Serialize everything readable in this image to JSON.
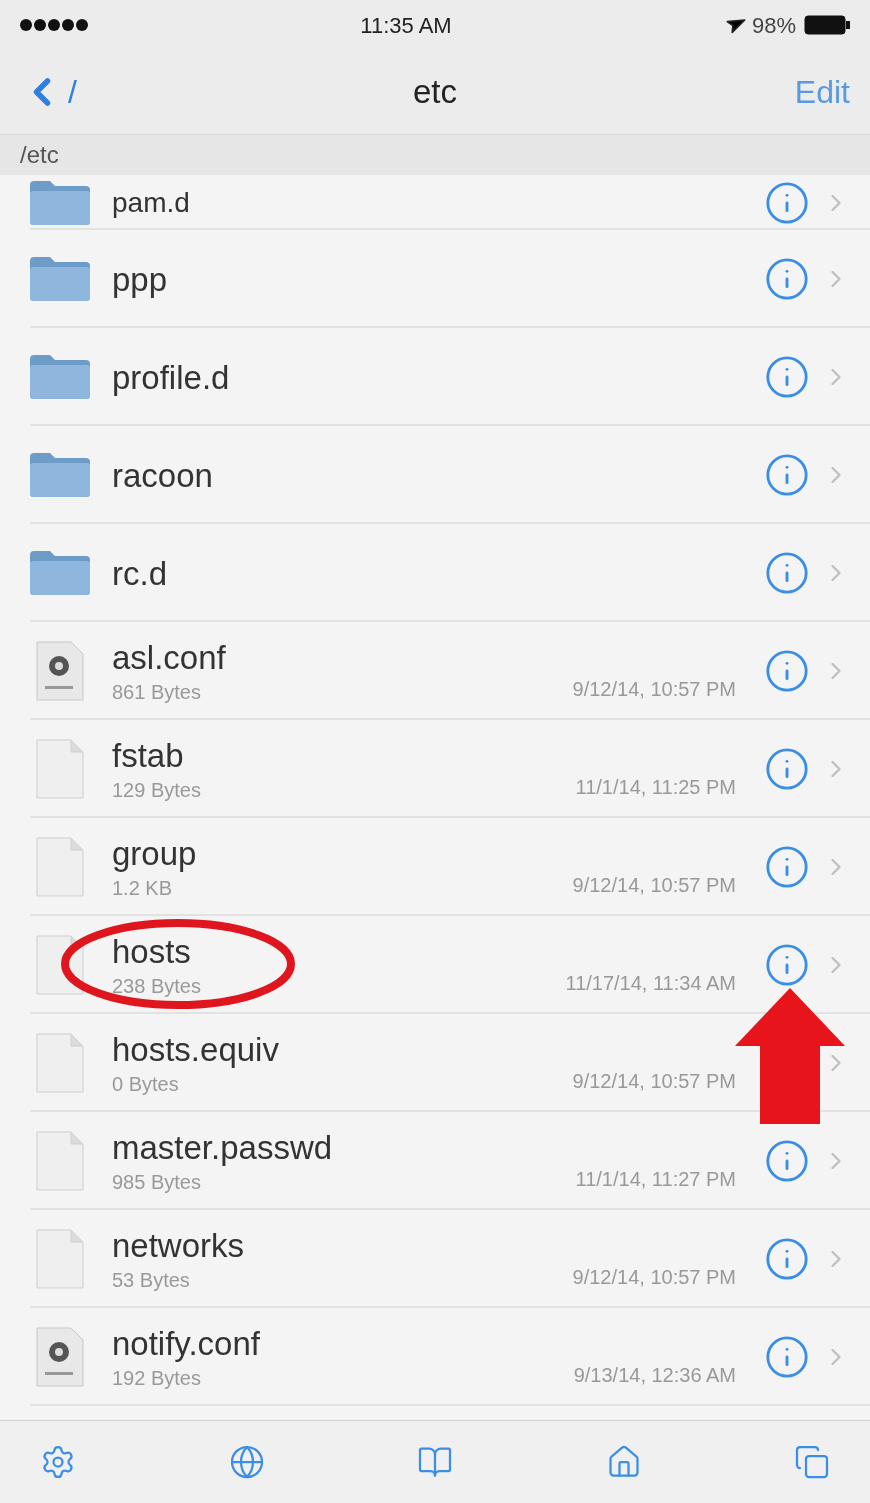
{
  "status_bar": {
    "time": "11:35 AM",
    "battery": "98%"
  },
  "nav": {
    "back": "/",
    "title": "etc",
    "edit": "Edit"
  },
  "path": "/etc",
  "rows": [
    {
      "kind": "folder",
      "name": "pam.d",
      "partial": true
    },
    {
      "kind": "folder",
      "name": "ppp"
    },
    {
      "kind": "folder",
      "name": "profile.d"
    },
    {
      "kind": "folder",
      "name": "racoon"
    },
    {
      "kind": "folder",
      "name": "rc.d"
    },
    {
      "kind": "config",
      "name": "asl.conf",
      "size": "861 Bytes",
      "date": "9/12/14, 10:57 PM"
    },
    {
      "kind": "file",
      "name": "fstab",
      "size": "129 Bytes",
      "date": "11/1/14, 11:25 PM"
    },
    {
      "kind": "file",
      "name": "group",
      "size": "1.2 KB",
      "date": "9/12/14, 10:57 PM"
    },
    {
      "kind": "file",
      "name": "hosts",
      "size": "238 Bytes",
      "date": "11/17/14, 11:34 AM",
      "circled": true,
      "arrowed": true
    },
    {
      "kind": "file",
      "name": "hosts.equiv",
      "size": "0 Bytes",
      "date": "9/12/14, 10:57 PM",
      "info_covered": true
    },
    {
      "kind": "file",
      "name": "master.passwd",
      "size": "985 Bytes",
      "date": "11/1/14, 11:27 PM"
    },
    {
      "kind": "file",
      "name": "networks",
      "size": "53 Bytes",
      "date": "9/12/14, 10:57 PM"
    },
    {
      "kind": "config",
      "name": "notify.conf",
      "size": "192 Bytes",
      "date": "9/13/14, 12:36 AM"
    }
  ],
  "toolbar": [
    {
      "kind": "settings"
    },
    {
      "kind": "globe"
    },
    {
      "kind": "bookmarks"
    },
    {
      "kind": "home"
    },
    {
      "kind": "windows"
    }
  ]
}
